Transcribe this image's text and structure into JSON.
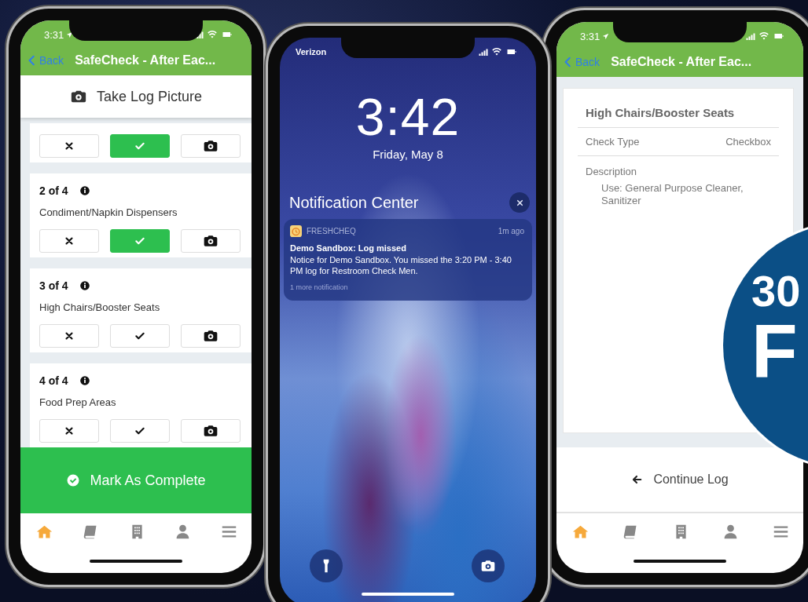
{
  "checklist_phone": {
    "status_time": "3:31",
    "back": "Back",
    "title": "SafeCheck - After Eac...",
    "take_picture": "Take Log Picture",
    "items": [
      {
        "checked": true
      },
      {
        "counter": "2 of 4",
        "name": "Condiment/Napkin Dispensers",
        "checked": true
      },
      {
        "counter": "3 of 4",
        "name": "High Chairs/Booster Seats",
        "checked": false
      },
      {
        "counter": "4 of 4",
        "name": "Food Prep Areas",
        "checked": false
      }
    ],
    "complete_button": "Mark As Complete",
    "tabs": [
      {
        "kind": "home",
        "selected": true
      },
      {
        "kind": "book",
        "selected": false
      },
      {
        "kind": "building",
        "selected": false
      },
      {
        "kind": "person",
        "selected": false
      },
      {
        "kind": "menu",
        "selected": false
      }
    ]
  },
  "lock_phone": {
    "carrier": "Verizon",
    "time": "3:42",
    "date": "Friday, May 8",
    "center_title": "Notification Center",
    "notification": {
      "app": "FRESHCHEQ",
      "age": "1m ago",
      "title": "Demo Sandbox: Log missed",
      "body": "Notice for Demo Sandbox. You missed the 3:20 PM - 3:40 PM log for Restroom Check Men.",
      "more": "1 more notification"
    }
  },
  "detail_phone": {
    "status_time": "3:31",
    "back": "Back",
    "title": "SafeCheck - After Eac...",
    "heading": "High Chairs/Booster Seats",
    "rows": [
      {
        "label": "Check Type",
        "value": "Checkbox"
      }
    ],
    "description_label": "Description",
    "description": "Use: General Purpose Cleaner, Sanitizer",
    "continue_button": "Continue Log",
    "tabs": [
      {
        "kind": "home",
        "selected": true
      },
      {
        "kind": "book",
        "selected": false
      },
      {
        "kind": "building",
        "selected": false
      },
      {
        "kind": "person",
        "selected": false
      },
      {
        "kind": "menu",
        "selected": false
      }
    ]
  },
  "badge": {
    "line_1": "30",
    "line_2": "F"
  }
}
